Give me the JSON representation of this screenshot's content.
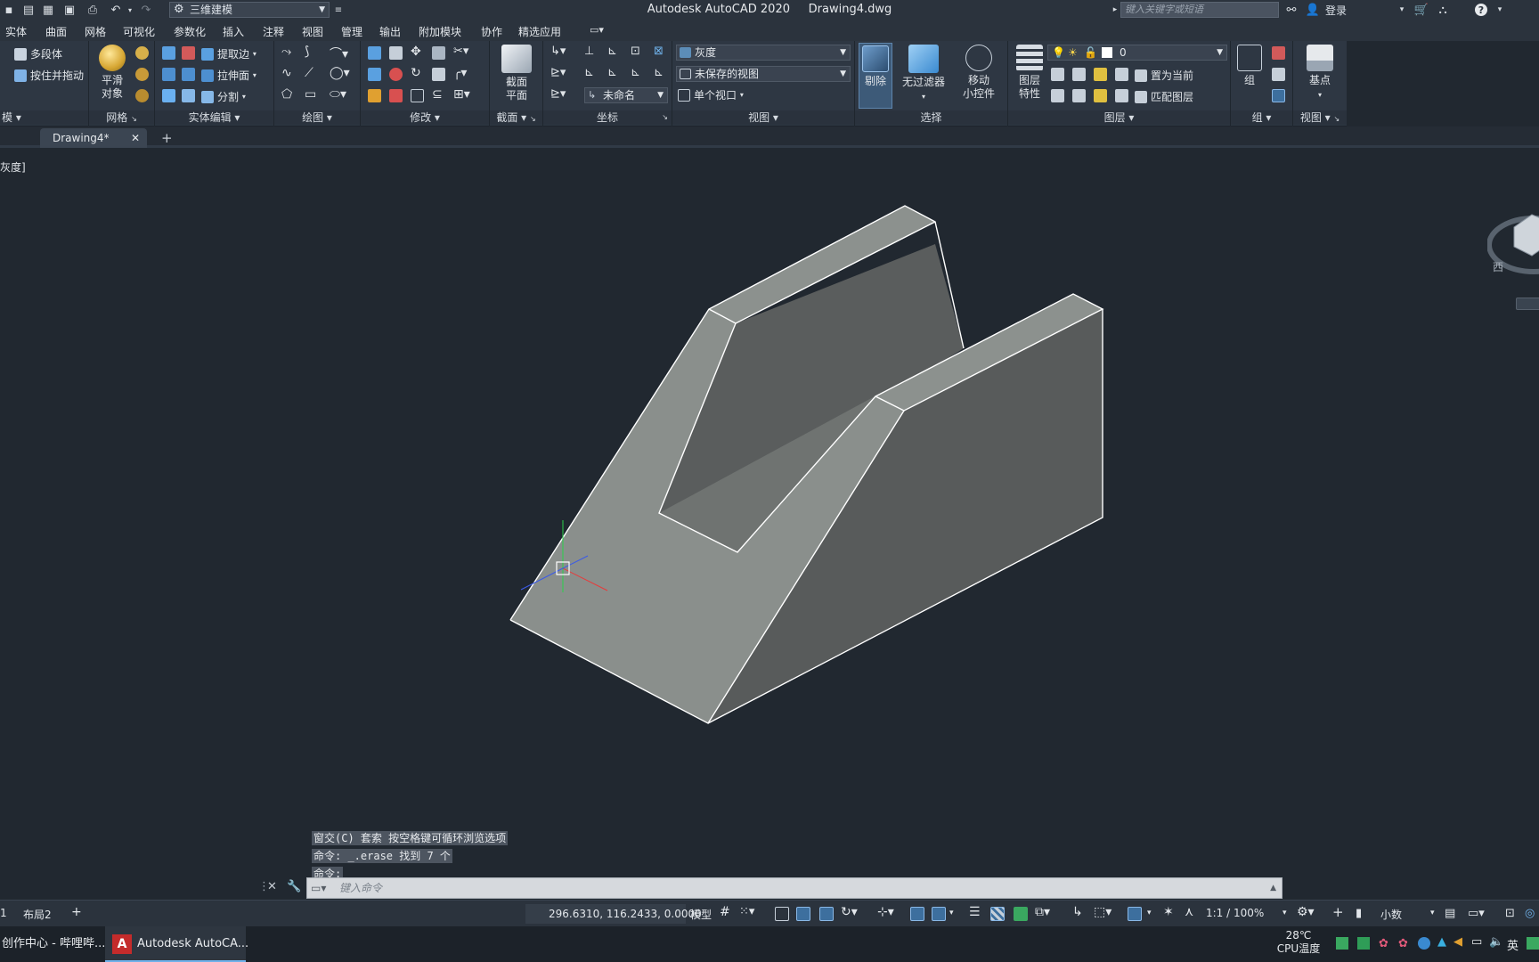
{
  "window": {
    "app_title": "Autodesk AutoCAD 2020",
    "file_name": "Drawing4.dwg"
  },
  "quick_access": {
    "workspace": "三维建模",
    "search_placeholder": "键入关键字或短语",
    "login": "登录"
  },
  "menu": [
    "实体",
    "曲面",
    "网格",
    "可视化",
    "参数化",
    "插入",
    "注释",
    "视图",
    "管理",
    "输出",
    "附加模块",
    "协作",
    "精选应用"
  ],
  "ribbon": {
    "modeling": {
      "title": "模",
      "polysolid": "多段体",
      "presspull": "按住并拖动"
    },
    "mesh": {
      "title": "网格",
      "smooth_line1": "平滑",
      "smooth_line2": "对象"
    },
    "solid_edit": {
      "title": "实体编辑",
      "extract_edges": "提取边",
      "extrude_faces": "拉伸面",
      "separate": "分割"
    },
    "draw": {
      "title": "绘图"
    },
    "modify": {
      "title": "修改"
    },
    "section": {
      "title": "截面",
      "plane_line1": "截面",
      "plane_line2": "平面"
    },
    "coordinates": {
      "title": "坐标",
      "ucs_name": "未命名"
    },
    "view": {
      "title": "视图",
      "visual_style": "灰度",
      "named_view": "未保存的视图",
      "viewport": "单个视口"
    },
    "selection": {
      "title": "选择",
      "cull": "剔除",
      "no_filter": "无过滤器",
      "gizmo_line1": "移动",
      "gizmo_line2": "小控件"
    },
    "layers": {
      "title": "图层",
      "props_line1": "图层",
      "props_line2": "特性",
      "current_layer": "0",
      "make_current": "置为当前",
      "match_layer": "匹配图层"
    },
    "group": {
      "title": "组",
      "label": "组"
    },
    "view2": {
      "title": "视图",
      "base": "基点"
    }
  },
  "tabs": {
    "active": "Drawing4*"
  },
  "viewport": {
    "label": "灰度]",
    "viewcube_face": "西"
  },
  "command": {
    "history": [
      "窗交(C) 套索  按空格键可循环浏览选项",
      "命令: _.erase 找到 7 个",
      "命令:"
    ],
    "placeholder": "键入命令"
  },
  "layout_tabs": [
    "1",
    "布局2"
  ],
  "status": {
    "coords": "296.6310, 116.2433, 0.0000",
    "model": "模型",
    "scale": "1:1 / 100%",
    "units": "小数"
  },
  "taskbar": {
    "item1": "创作中心 - 哔哩哔...",
    "item2": "Autodesk AutoCA...",
    "temp": "28℃",
    "cpu": "CPU温度",
    "ime": "英"
  },
  "colors": {
    "face_light": "#8a8f8c",
    "face_dark": "#575a5a",
    "face_mid": "#6f7371",
    "edge": "#ffffff",
    "background": "#212830"
  }
}
